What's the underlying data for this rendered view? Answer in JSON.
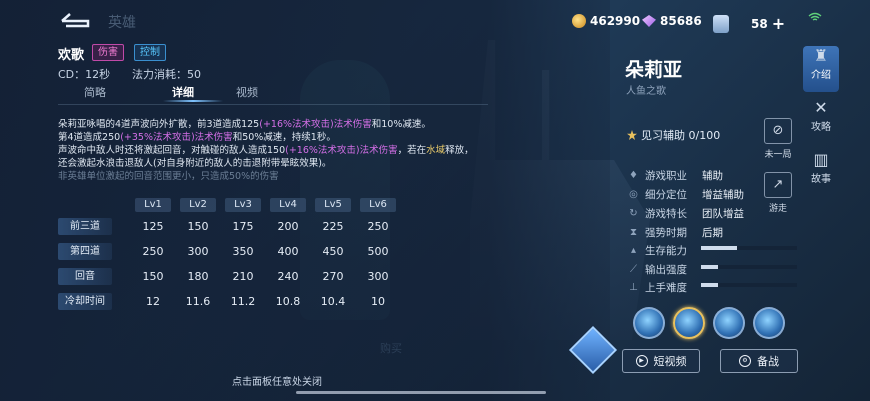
{
  "header": {
    "title": "英雄",
    "gold": "462990",
    "gems": "85686",
    "cards": "58"
  },
  "skill": {
    "name": "欢歌",
    "tag_damage": "伤害",
    "tag_control": "控制",
    "cooldown": "CD：12秒",
    "mana": "法力消耗：50",
    "tabs": [
      "简略",
      "详细",
      "视频"
    ],
    "active_tab": "详细",
    "desc_line1_a": "朵莉亚咏唱的4道声波向外扩散，前3道造成125",
    "desc_line1_b": "(+16%法术攻击)法术伤害",
    "desc_line1_c": "和10%减速。",
    "desc_line2_a": "第4道造成250",
    "desc_line2_b": "(+35%法术攻击)法术伤害",
    "desc_line2_c": "和50%减速，持续1秒。",
    "desc_line3_a": "声波命中敌人时还将激起回音，对触碰的敌人造成150",
    "desc_line3_b": "(+16%法术攻击)法术伤害",
    "desc_line3_c": "，若在",
    "desc_line3_d": "水域",
    "desc_line3_e": "释放，",
    "desc_line4": "还会激起水浪击退敌人(对自身附近的敌人的击退附带晕眩效果)。",
    "desc_line5": "非英雄单位激起的回音范围更小，只造成50%的伤害"
  },
  "table": {
    "levels": [
      "Lv1",
      "Lv2",
      "Lv3",
      "Lv4",
      "Lv5",
      "Lv6"
    ],
    "rows": [
      {
        "label": "前三道",
        "values": [
          "125",
          "150",
          "175",
          "200",
          "225",
          "250"
        ]
      },
      {
        "label": "第四道",
        "values": [
          "250",
          "300",
          "350",
          "400",
          "450",
          "500"
        ]
      },
      {
        "label": "回音",
        "values": [
          "150",
          "180",
          "210",
          "240",
          "270",
          "300"
        ]
      },
      {
        "label": "冷却时间",
        "values": [
          "12",
          "11.6",
          "11.2",
          "10.8",
          "10.4",
          "10"
        ]
      }
    ]
  },
  "close_tip": "点击面板任意处关闭",
  "hero": {
    "name": "朵莉亚",
    "subtitle": "人鱼之歌",
    "proficiency": "见习辅助 0/100",
    "btn_first": "未一局",
    "btn_roam": "游走",
    "role_label": "游戏职业",
    "role_value": "辅助",
    "position_label": "细分定位",
    "position_value": "增益辅助",
    "specialty_label": "游戏特长",
    "specialty_value": "团队增益",
    "power_label": "强势时期",
    "power_value": "后期",
    "survival_label": "生存能力",
    "survival_level": 0.38,
    "output_label": "输出强度",
    "output_level": 0.18,
    "difficulty_label": "上手难度",
    "difficulty_level": 0.18,
    "video_btn": "短视频",
    "battle_btn": "备战"
  },
  "nav": {
    "intro": "介绍",
    "strategy": "攻略",
    "story": "故事"
  },
  "ghost_text": {
    "left": "购买"
  }
}
